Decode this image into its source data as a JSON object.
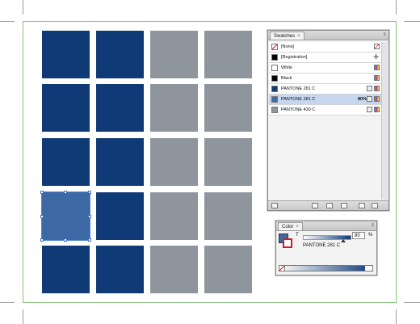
{
  "swatches_panel": {
    "tab_label": "Swatches",
    "close_glyph": "×",
    "menu_glyph": "≡",
    "items": [
      {
        "name": "[None]",
        "chip": "none",
        "tint": "",
        "icon": "none-icon"
      },
      {
        "name": "[Registration]",
        "chip": "#000000",
        "tint": "",
        "icon": "registration-icon"
      },
      {
        "name": "White",
        "chip": "#ffffff",
        "tint": "",
        "icon": "process-icon"
      },
      {
        "name": "Black",
        "chip": "#000000",
        "tint": "",
        "icon": "process-icon"
      },
      {
        "name": "PANTONE 281 C",
        "chip": "#0f3a76",
        "tint": "",
        "icon": "spot-icon"
      },
      {
        "name": "PANTONE 281 C",
        "chip": "#3f6aa5",
        "tint": "80%",
        "icon": "spot-icon"
      },
      {
        "name": "PANTONE 430 C",
        "chip": "#8f959c",
        "tint": "",
        "icon": "spot-icon"
      }
    ]
  },
  "color_panel": {
    "tab_label": "Color",
    "close_glyph": "×",
    "tint_label": "T",
    "tint_value": "80",
    "percent": "%",
    "color_name": "PANTONE 281 C"
  },
  "colors": {
    "navy": "#0f3a76",
    "selected_tint": "#3c68a3",
    "gray": "#8f959c",
    "bleed_guide": "#86c47a"
  }
}
